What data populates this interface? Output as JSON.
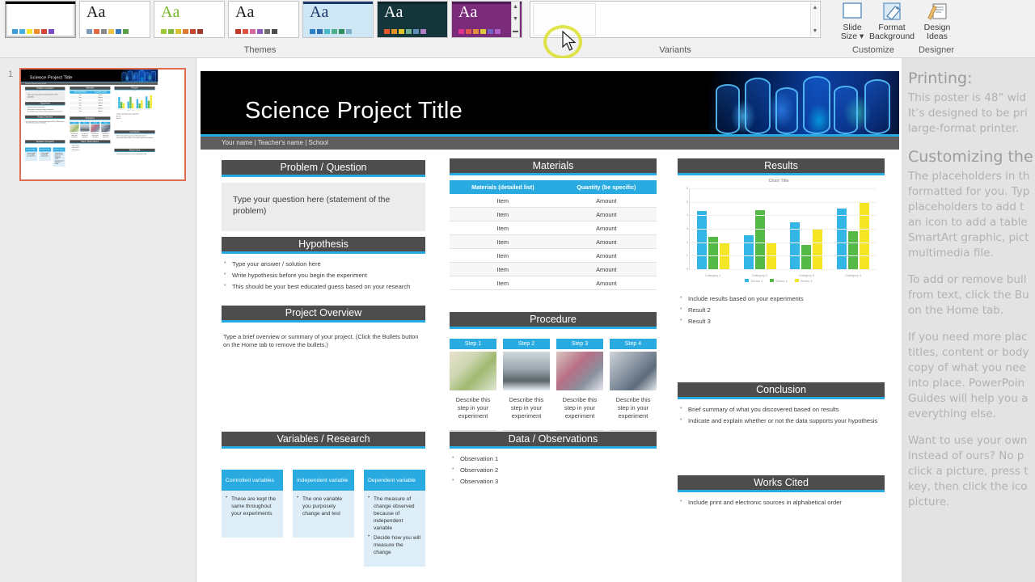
{
  "ribbon": {
    "groups": [
      {
        "label": "Themes"
      },
      {
        "label": "Variants"
      },
      {
        "label": "Customize"
      },
      {
        "label": "Designer"
      }
    ],
    "theme_aa": "Aa",
    "themes": [
      {
        "name": "office-theme",
        "aa_color": "#000000",
        "bg": "#ffffff",
        "topbar": "#000000",
        "swatches": [
          "#3d9bd6",
          "#45b0e0",
          "#f2e335",
          "#ef8b2c",
          "#d6443a",
          "#7a4fc4"
        ]
      },
      {
        "name": "facet-theme",
        "aa_color": "#1c1c1c",
        "bg": "#ffffff",
        "topbar": "#ffffff",
        "swatches": [
          "#7f9db9",
          "#e06a3d",
          "#8a8a8a",
          "#f0c24a",
          "#3a7abf",
          "#5aa046"
        ]
      },
      {
        "name": "ion-theme",
        "aa_color": "#76b82a",
        "bg": "#ffffff",
        "topbar": "#ffffff",
        "swatches": [
          "#9ec93a",
          "#7fb83c",
          "#d8c02e",
          "#e07a2e",
          "#c8452f",
          "#9e3a2c"
        ]
      },
      {
        "name": "retrospect-theme",
        "aa_color": "#1c1c1c",
        "bg": "#ffffff",
        "topbar": "#ffffff",
        "swatches": [
          "#c0392b",
          "#e0523d",
          "#d56aa0",
          "#8e5fbf",
          "#6f6f6f",
          "#4b4b4b"
        ]
      },
      {
        "name": "damask-theme",
        "aa_color": "#1b3a6b",
        "bg": "#cfe7f5",
        "topbar": "#1b3a6b",
        "swatches": [
          "#2b7fc4",
          "#2f6fb0",
          "#49b8c9",
          "#4fae8b",
          "#2f8f5c",
          "#7fb0c9"
        ]
      },
      {
        "name": "dividend-theme",
        "aa_color": "#ffffff",
        "bg": "#14353a",
        "topbar": "#0c2428",
        "swatches": [
          "#e05a2b",
          "#e0922b",
          "#e0c22b",
          "#6fae8f",
          "#5f8fb8",
          "#b07fc4"
        ]
      },
      {
        "name": "berlin-theme",
        "aa_color": "#ffffff",
        "bg": "#7a2b7a",
        "topbar": "#4b1a52",
        "swatches": [
          "#e0348b",
          "#e05a4b",
          "#e0903c",
          "#d9c83a",
          "#6f5fc4",
          "#b05fc4"
        ]
      }
    ],
    "gallery_scroll": {
      "up": "▲",
      "down": "▼",
      "more": "▬"
    },
    "variants_scroll": {
      "up": "▲",
      "down": "▼"
    },
    "buttons": [
      {
        "name": "slide-size-button",
        "line1": "Slide",
        "line2": "Size ▾"
      },
      {
        "name": "format-background-button",
        "line1": "Format",
        "line2": "Background"
      },
      {
        "name": "design-ideas-button",
        "line1": "Design",
        "line2": "Ideas"
      }
    ],
    "collapse_caret": "∧"
  },
  "thumbnails": {
    "slide_number": "1"
  },
  "slide": {
    "title": "Science Project Title",
    "byline": "Your name | Teacher's name | School",
    "problem": {
      "heading": "Problem / Question",
      "text": "Type your question here (statement of the problem)"
    },
    "hypothesis": {
      "heading": "Hypothesis",
      "bullets": [
        "Type your answer / solution here",
        "Write hypothesis before you begin the experiment",
        "This should be your best educated guess based on your research"
      ]
    },
    "overview": {
      "heading": "Project Overview",
      "text": "Type a brief overview or summary of your project. (Click the Bullets button on the Home tab to remove the bullets.)"
    },
    "variables": {
      "heading": "Variables / Research",
      "cards": [
        {
          "title": "Controlled variables",
          "bullets": [
            "These are kept the same throughout your experiments"
          ]
        },
        {
          "title": "Independent variable",
          "bullets": [
            "The one variable you purposely change and test"
          ]
        },
        {
          "title": "Dependent variable",
          "bullets": [
            "The measure of change observed because of independent variable",
            "Decide how you will measure the change"
          ]
        }
      ]
    },
    "materials": {
      "heading": "Materials",
      "columns": [
        "Materials (detailed list)",
        "Quantity (be specific)"
      ],
      "rows": [
        [
          "Item",
          "Amount"
        ],
        [
          "Item",
          "Amount"
        ],
        [
          "Item",
          "Amount"
        ],
        [
          "Item",
          "Amount"
        ],
        [
          "Item",
          "Amount"
        ],
        [
          "Item",
          "Amount"
        ],
        [
          "Item",
          "Amount"
        ]
      ]
    },
    "procedure": {
      "heading": "Procedure",
      "steps": [
        {
          "label": "Step 1",
          "text": "Describe this step in your experiment"
        },
        {
          "label": "Step 2",
          "text": "Describe this step in your experiment"
        },
        {
          "label": "Step 3",
          "text": "Describe this step in your experiment"
        },
        {
          "label": "Step 4",
          "text": "Describe this step in your experiment"
        }
      ]
    },
    "observations": {
      "heading": "Data / Observations",
      "bullets": [
        "Observation 1",
        "Observation 2",
        "Observation 3"
      ]
    },
    "results": {
      "heading": "Results",
      "bullets": [
        "Include results based on your experiments",
        "Result 2",
        "Result 3"
      ]
    },
    "conclusion": {
      "heading": "Conclusion",
      "bullets": [
        "Brief summary of what you discovered based on results",
        "Indicate and explain whether or not the data supports your hypothesis"
      ]
    },
    "works_cited": {
      "heading": "Works Cited",
      "bullets": [
        "Include print and electronic sources in alphabetical order"
      ]
    }
  },
  "chart_data": {
    "type": "bar",
    "title": "Chart Title",
    "xlabel": "",
    "ylabel": "",
    "categories": [
      "Category 1",
      "Category 2",
      "Category 3",
      "Category 4"
    ],
    "series": [
      {
        "name": "Series 1",
        "color": "#33b5e5",
        "values": [
          4.3,
          2.5,
          3.5,
          4.5
        ]
      },
      {
        "name": "Series 2",
        "color": "#55b947",
        "values": [
          2.4,
          4.4,
          1.8,
          2.8
        ]
      },
      {
        "name": "Series 3",
        "color": "#f4e625",
        "values": [
          2.0,
          2.0,
          3.0,
          5.0
        ]
      }
    ],
    "ylim": [
      0,
      6
    ],
    "yticks": [
      0,
      1,
      2,
      3,
      4,
      5,
      6
    ],
    "grid": true,
    "legend_position": "bottom"
  },
  "notes": {
    "sections": [
      {
        "heading": "Printing:",
        "lines": [
          "This poster is 48” wid",
          "It’s designed to be pri",
          "large-format printer."
        ]
      },
      {
        "heading": "Customizing the",
        "lines": [
          "The placeholders in th",
          "formatted for you. Typ",
          "placeholders to add t",
          "an icon to add a table",
          "SmartArt graphic, pict",
          "multimedia file."
        ]
      },
      {
        "heading": "",
        "lines": [
          "To add or remove bull",
          "from text, click the Bu",
          "on the Home tab."
        ]
      },
      {
        "heading": "",
        "lines": [
          "If you need more plac",
          "titles, content or body",
          "copy of what you nee",
          "into place. PowerPoin",
          "Guides will help you a",
          "everything else."
        ]
      },
      {
        "heading": "",
        "lines": [
          "Want to use your own",
          "instead of ours? No p",
          "click a picture, press t",
          "key, then click the ico",
          "picture."
        ]
      }
    ]
  },
  "colors": {
    "accent_blue": "#27a9e1",
    "header_gray": "#4d4d4d",
    "card_blue": "#29abe2",
    "card_fill": "#ddeef9",
    "selection_orange": "#e06c4f",
    "click_highlight": "#d9e02a"
  }
}
